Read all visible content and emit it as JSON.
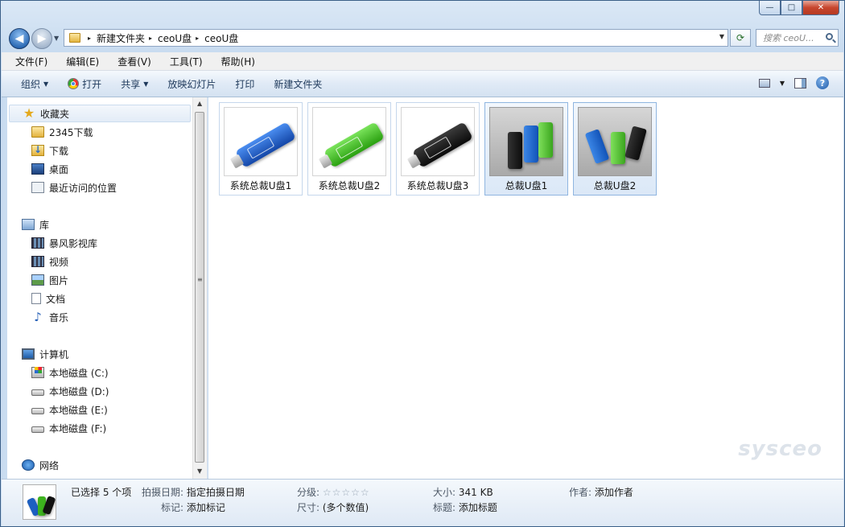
{
  "window": {
    "controls": {
      "minimize": "—",
      "maximize": "□",
      "close": "✕"
    }
  },
  "address": {
    "back": "◀",
    "forward": "▶",
    "crumb_separator": "▸",
    "breadcrumbs": [
      "新建文件夹",
      "ceoU盘",
      "ceoU盘"
    ],
    "search_placeholder": "搜索 ceoU..."
  },
  "menu": [
    "文件(F)",
    "编辑(E)",
    "查看(V)",
    "工具(T)",
    "帮助(H)"
  ],
  "toolbar": {
    "organize": "组织",
    "open": "打开",
    "share": "共享",
    "slideshow": "放映幻灯片",
    "print": "打印",
    "new_folder": "新建文件夹",
    "help": "?"
  },
  "nav": {
    "favorites": "收藏夹",
    "fav_items": [
      "2345下载",
      "下载",
      "桌面",
      "最近访问的位置"
    ],
    "libraries": "库",
    "lib_items": [
      "暴风影视库",
      "视频",
      "图片",
      "文档",
      "音乐"
    ],
    "computer": "计算机",
    "drives": [
      "本地磁盘 (C:)",
      "本地磁盘 (D:)",
      "本地磁盘 (E:)",
      "本地磁盘 (F:)"
    ],
    "network": "网络"
  },
  "files": [
    {
      "name": "系统总裁U盘1",
      "selected": false,
      "color": "#1e63d6"
    },
    {
      "name": "系统总裁U盘2",
      "selected": false,
      "color": "#3cc11d"
    },
    {
      "name": "系统总裁U盘3",
      "selected": false,
      "color": "#1c1c1c"
    },
    {
      "name": "总裁U盘1",
      "selected": true
    },
    {
      "name": "总裁U盘2",
      "selected": true
    }
  ],
  "watermark": "sysceo",
  "details": {
    "selected": "已选择 5 个项",
    "date_key": "拍摄日期:",
    "date_val": "指定拍摄日期",
    "tags_key": "标记:",
    "tags_val": "添加标记",
    "rating_key": "分级:",
    "rating_val": "☆☆☆☆☆",
    "dims_key": "尺寸:",
    "dims_val": "(多个数值)",
    "size_key": "大小:",
    "size_val": "341 KB",
    "title_key": "标题:",
    "title_val": "添加标题",
    "author_key": "作者:",
    "author_val": "添加作者"
  }
}
